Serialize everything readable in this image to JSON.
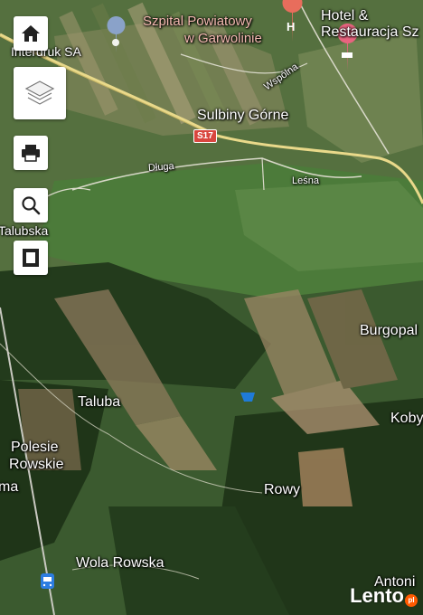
{
  "toolbar": {
    "home": "home-icon",
    "layers": "layers-icon",
    "print": "printer-icon",
    "search": "search-icon",
    "frame": "frame-icon"
  },
  "places": {
    "interdruk": "Interdruk SA",
    "szpital_1": "Szpital Powiatowy",
    "szpital_2": "w Garwolinie",
    "hotel_1": "Hotel &",
    "hotel_2": "Restauracja Sz",
    "wspolna": "Wspólna",
    "sulbiny": "Sulbiny Górne",
    "s17": "S17",
    "dluga": "Długa",
    "lesna": "Leśna",
    "talubska": "Talubska",
    "burgopal": "Burgopal",
    "taluba": "Taluba",
    "koby": "Koby",
    "polesie_1": "Polesie",
    "polesie_2": "Rowskie",
    "ma": "ma",
    "rowy": "Rowy",
    "wola": "Wola Rowska",
    "antoni": "Antoni"
  },
  "watermark": {
    "text": "Lento",
    "badge": "pl"
  },
  "colors": {
    "road": "#e9d98a",
    "hospital": "#e86d5c",
    "hotel": "#e8647f",
    "poi_pin": "#8aa2c9",
    "water": "#1f7bd8",
    "transit": "#2c7de0"
  }
}
